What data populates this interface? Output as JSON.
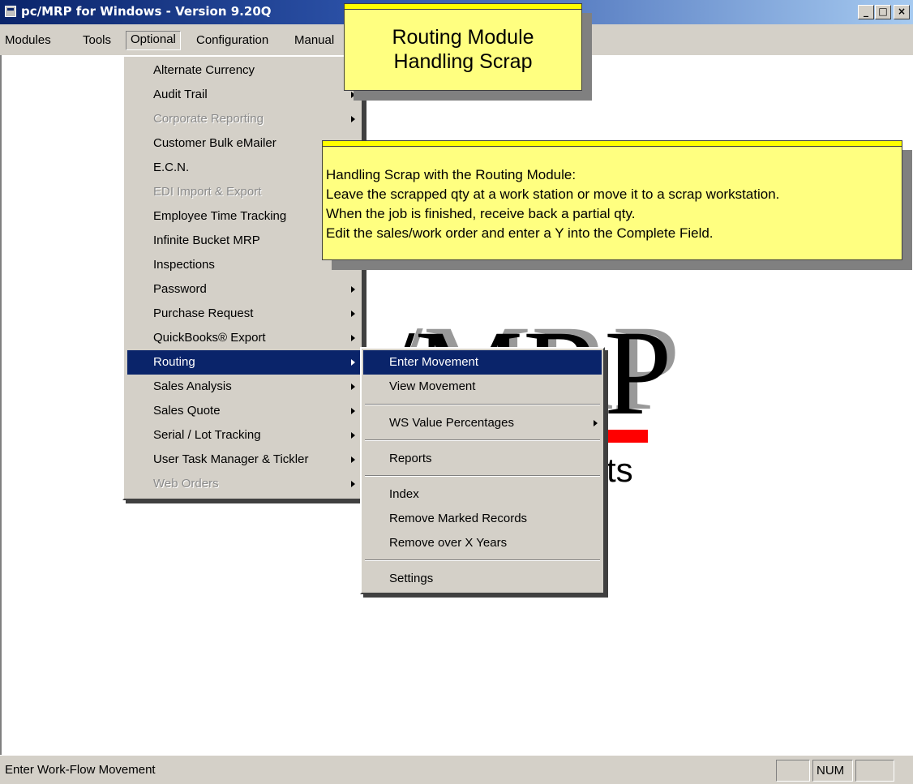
{
  "window": {
    "title": "pc/MRP for Windows - Version 9.20Q",
    "minimize": "_",
    "maximize": "□",
    "close": "×"
  },
  "menubar": {
    "items": [
      "Modules",
      "Tools",
      "Optional",
      "Configuration",
      "Manual"
    ]
  },
  "optional_menu": {
    "items": [
      {
        "label": "Alternate Currency",
        "submenu": false,
        "disabled": false
      },
      {
        "label": "Audit Trail",
        "submenu": true,
        "disabled": false
      },
      {
        "label": "Corporate Reporting",
        "submenu": true,
        "disabled": true
      },
      {
        "label": "Customer Bulk eMailer",
        "submenu": false,
        "disabled": false
      },
      {
        "label": "E.C.N.",
        "submenu": false,
        "disabled": false
      },
      {
        "label": "EDI Import & Export",
        "submenu": false,
        "disabled": true
      },
      {
        "label": "Employee Time Tracking",
        "submenu": false,
        "disabled": false
      },
      {
        "label": "Infinite Bucket MRP",
        "submenu": false,
        "disabled": false
      },
      {
        "label": "Inspections",
        "submenu": false,
        "disabled": false
      },
      {
        "label": "Password",
        "submenu": true,
        "disabled": false
      },
      {
        "label": "Purchase Request",
        "submenu": true,
        "disabled": false
      },
      {
        "label": "QuickBooks® Export",
        "submenu": true,
        "disabled": false
      },
      {
        "label": "Routing",
        "submenu": true,
        "disabled": false,
        "selected": true
      },
      {
        "label": "Sales Analysis",
        "submenu": true,
        "disabled": false
      },
      {
        "label": "Sales Quote",
        "submenu": true,
        "disabled": false
      },
      {
        "label": "Serial / Lot Tracking",
        "submenu": true,
        "disabled": false
      },
      {
        "label": "User Task Manager & Tickler",
        "submenu": true,
        "disabled": false
      },
      {
        "label": "Web Orders",
        "submenu": true,
        "disabled": true
      }
    ]
  },
  "routing_menu": {
    "enter_movement": "Enter  Movement",
    "view_movement": "View  Movement",
    "ws_value_percentages": "WS Value Percentages",
    "reports": "Reports",
    "index": "Index",
    "remove_marked": "Remove Marked Records",
    "remove_over_years": "Remove over X Years",
    "settings": "Settings"
  },
  "callout_title": {
    "line1": "Routing Module",
    "line2": "Handling Scrap"
  },
  "callout_body": {
    "line1": "Handling Scrap with the Routing Module:",
    "line2": "Leave the scrapped qty at a work station or move it to a scrap workstation.",
    "line3": "When the job is finished, receive back a partial qty.",
    "line4": "Edit the sales/work order and enter a Y into the Complete Field."
  },
  "logo": {
    "text": "/MRP",
    "subtext": "ts"
  },
  "statusbar": {
    "message": "Enter Work-Flow Movement",
    "num": "NUM"
  },
  "colors": {
    "menu_bg": "#d4d0c8",
    "highlight": "#0a246a",
    "callout_bg": "#ffff80"
  }
}
